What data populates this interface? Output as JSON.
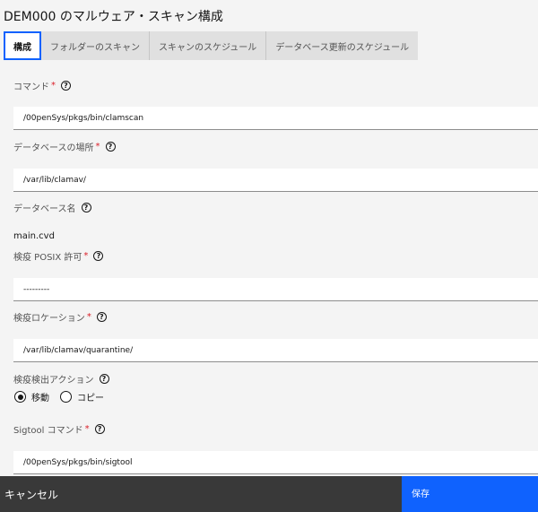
{
  "page_title": "DEM000 のマルウェア・スキャン構成",
  "tabs": [
    {
      "label": "構成"
    },
    {
      "label": "フォルダーのスキャン"
    },
    {
      "label": "スキャンのスケジュール"
    },
    {
      "label": "データベース更新のスケジュール"
    }
  ],
  "fields": {
    "command": {
      "label": "コマンド",
      "required": "*",
      "value": "/00penSys/pkgs/bin/clamscan"
    },
    "db_location": {
      "label": "データベースの場所",
      "required": "*",
      "value": "/var/lib/clamav/"
    },
    "db_name": {
      "label": "データベース名",
      "value": "main.cvd"
    },
    "quarantine_posix": {
      "label": "検疫 POSIX 許可",
      "required": "*",
      "value": "---------"
    },
    "quarantine_location": {
      "label": "検疫ロケーション",
      "required": "*",
      "value": "/var/lib/clamav/quarantine/"
    },
    "detect_action": {
      "label": "検疫検出アクション",
      "options": [
        "移動",
        "コピー"
      ],
      "selected": "移動"
    },
    "sigtool": {
      "label": "Sigtool コマンド",
      "required": "*",
      "value": "/00penSys/pkgs/bin/sigtool"
    }
  },
  "icons": {
    "help": "?"
  },
  "footer": {
    "cancel_label": "キャンセル",
    "save_label": "保存"
  },
  "colors": {
    "accent": "#0f62fe",
    "cancel_bg": "#393939",
    "required": "#da1e28"
  }
}
